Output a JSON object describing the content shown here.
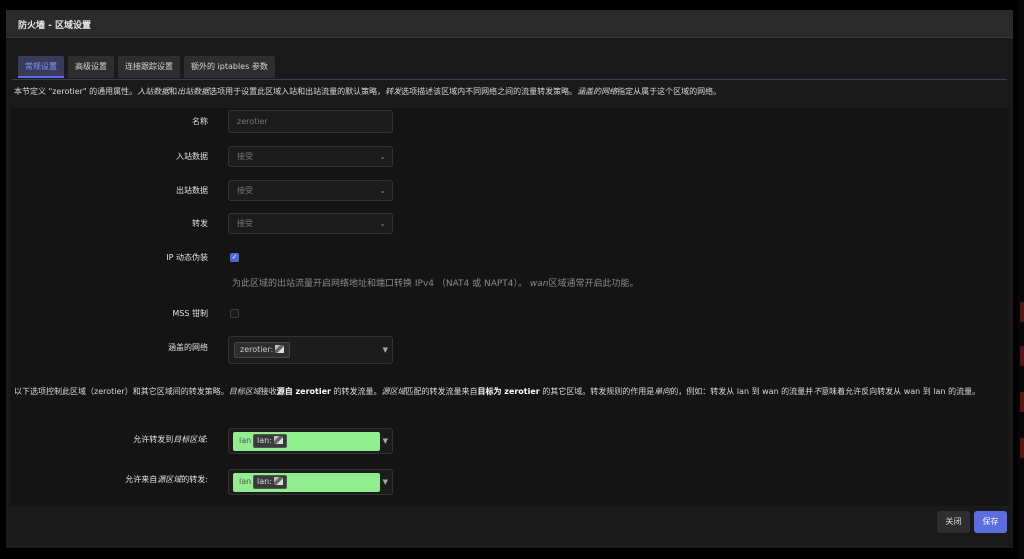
{
  "modal": {
    "title": "防火墙 - 区域设置"
  },
  "tabs": [
    "常规设置",
    "高级设置",
    "连接跟踪设置",
    "额外的 iptables 参数"
  ],
  "description": {
    "p1": "本节定义 \"zerotier\" 的通用属性。",
    "p1_em1": "入站数据",
    "p1_mid1": "和",
    "p1_em2": "出站数据",
    "p1_mid2": "选项用于设置此区域入站和出站流量的默认策略，",
    "p1_em3": "转发",
    "p1_mid3": "选项描述该区域内不同网络之间的流量转发策略。",
    "p1_em4": "涵盖的网络",
    "p1_end": "指定从属于这个区域的网络。"
  },
  "form": {
    "name_label": "名称",
    "name_placeholder": "zerotier",
    "input_label": "入站数据",
    "input_value": "接受",
    "output_label": "出站数据",
    "output_value": "接受",
    "forward_label": "转发",
    "forward_value": "接受",
    "masq_label": "IP 动态伪装",
    "masq_checked": true,
    "masq_hint_a": "为此区域的出站流量开启网络地址和端口转换 IPv4 （NAT4 或 NAPT4）。",
    "masq_hint_em": "wan",
    "masq_hint_b": "区域通常开启此功能。",
    "mss_label": "MSS 钳制",
    "mss_checked": false,
    "networks_label": "涵盖的网络",
    "networks_chip": "zerotier:",
    "to_label_a": "允许转发到",
    "to_label_em": "目标区域",
    "to_label_b": ":",
    "to_text": "lan",
    "to_chip": "lan:",
    "from_label_a": "允许来自",
    "from_label_em": "源区域",
    "from_label_b": "的转发:",
    "from_text": "lan",
    "from_chip": "lan:"
  },
  "forwarding_description": {
    "s1": "以下选项控制此区域（zerotier）和其它区域间的转发策略。",
    "s1_em": "目标区域",
    "s2": "接收",
    "s2_b": "源自 zerotier",
    "s3": " 的转发流量。",
    "s3_em": "源区域",
    "s4": "匹配的转发流量来自",
    "s4_b": "目标为 zerotier",
    "s5": " 的其它区域。转发规则的作用是",
    "s5_em": "单向",
    "s6": "的，例如：转发从 lan 到 wan 的流量并",
    "s6_em": "不",
    "s7": "意味着允许反向转发从 wan 到 lan 的流量。"
  },
  "buttons": {
    "close": "关闭",
    "save": "保存"
  },
  "colors": {
    "accent": "#5b6ee1",
    "zone_lan": "#90ee90"
  }
}
